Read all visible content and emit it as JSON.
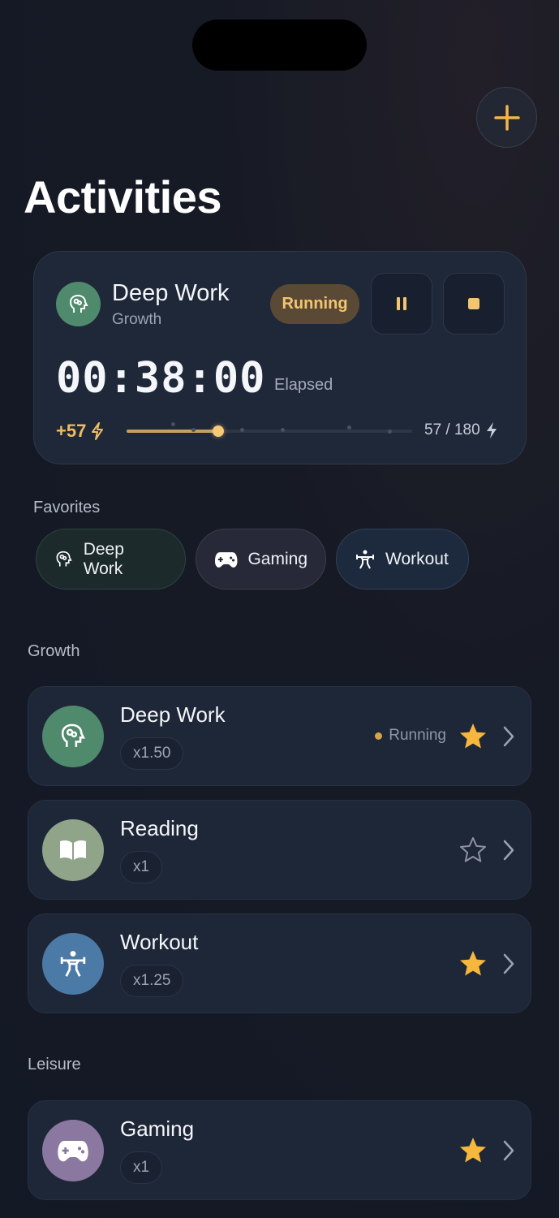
{
  "header": {
    "title": "Activities",
    "add_icon": "plus-icon"
  },
  "active_session": {
    "name": "Deep Work",
    "category": "Growth",
    "status": "Running",
    "timer": "00:38:00",
    "timer_label": "Elapsed",
    "points": "+57",
    "energy": "57 / 180",
    "progress": 0.32,
    "icon": "brain-icon",
    "colors": {
      "icon_bg": "#4f8a6c",
      "accent": "#f3c56f"
    }
  },
  "favorites": {
    "label": "Favorites",
    "items": [
      {
        "label": "Deep Work",
        "icon": "brain-icon"
      },
      {
        "label": "Gaming",
        "icon": "gamepad-icon"
      },
      {
        "label": "Workout",
        "icon": "weightlifting-icon"
      }
    ]
  },
  "sections": [
    {
      "label": "Growth",
      "items": [
        {
          "name": "Deep Work",
          "multiplier": "x1.50",
          "status": "Running",
          "favorite": true,
          "icon": "brain-icon",
          "color": "#4f8a6c"
        },
        {
          "name": "Reading",
          "multiplier": "x1",
          "status": "",
          "favorite": false,
          "icon": "book-icon",
          "color": "#8fa488"
        },
        {
          "name": "Workout",
          "multiplier": "x1.25",
          "status": "",
          "favorite": true,
          "icon": "weightlifting-icon",
          "color": "#4c7aa6"
        }
      ]
    },
    {
      "label": "Leisure",
      "items": [
        {
          "name": "Gaming",
          "multiplier": "x1",
          "status": "",
          "favorite": true,
          "icon": "gamepad-icon",
          "color": "#8a78a0"
        }
      ]
    }
  ]
}
